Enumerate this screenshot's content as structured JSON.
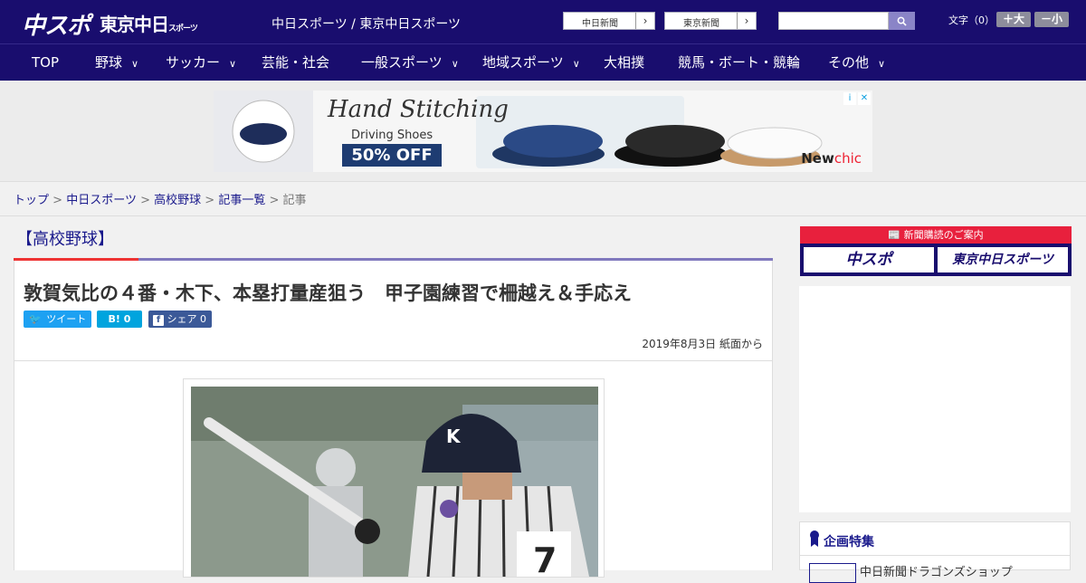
{
  "header": {
    "logo_primary": "中スポ",
    "logo_secondary": "東京中日",
    "logo_secondary_small": "スポーツ",
    "site_title": "中日スポーツ / 東京中日スポーツ",
    "paper_links": [
      "中日新聞",
      "東京新聞"
    ],
    "font_size_label": "文字（0）",
    "font_increase": "＋大",
    "font_decrease": "－小",
    "search_placeholder": ""
  },
  "nav": {
    "items": [
      {
        "label": "TOP",
        "has_menu": false
      },
      {
        "label": "野球",
        "has_menu": true
      },
      {
        "label": "サッカー",
        "has_menu": true
      },
      {
        "label": "芸能・社会",
        "has_menu": false
      },
      {
        "label": "一般スポーツ",
        "has_menu": true
      },
      {
        "label": "地域スポーツ",
        "has_menu": true
      },
      {
        "label": "大相撲",
        "has_menu": false
      },
      {
        "label": "競馬・ボート・競輪",
        "has_menu": false
      },
      {
        "label": "その他",
        "has_menu": true
      }
    ]
  },
  "ad": {
    "title": "Hand Stitching",
    "subtitle": "Driving Shoes",
    "offer": "50% OFF",
    "brand_a": "New",
    "brand_b": "chic"
  },
  "breadcrumb": {
    "items": [
      "トップ",
      "中日スポーツ",
      "高校野球",
      "記事一覧"
    ],
    "current": "記事",
    "separator": ">"
  },
  "article": {
    "category": "【高校野球】",
    "headline": "敦賀気比の４番・木下、本塁打量産狙う　甲子園練習で柵越え＆手応え",
    "share": {
      "tweet": "ツイート",
      "hatena": "B! 0",
      "facebook": "シェア 0"
    },
    "date": "2019年8月3日 紙面から"
  },
  "sidebar": {
    "promo_label": "新聞購読のご案内",
    "promo_items": [
      "中スポ",
      "東京中日スポーツ"
    ],
    "feature_title": "企画特集",
    "feature_item": "中日新聞ドラゴンズショップ"
  },
  "colors": {
    "brand_navy": "#190d6e",
    "accent_red": "#e33333",
    "link_blue": "#1a1a8c"
  }
}
